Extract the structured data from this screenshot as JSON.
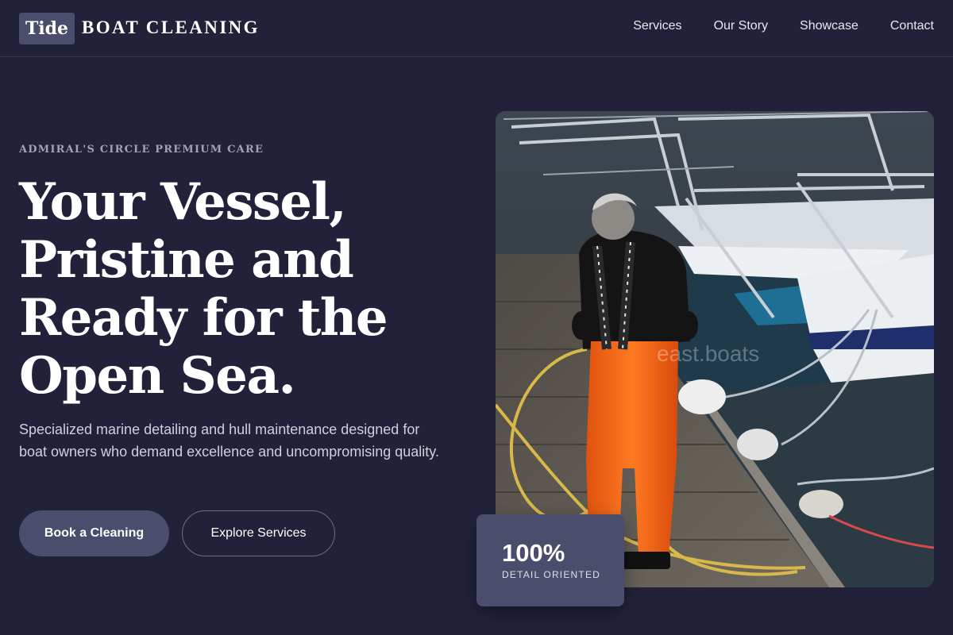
{
  "brand": {
    "logo_mark": "Tide",
    "name": "BOAT CLEANING"
  },
  "nav": {
    "items": [
      {
        "label": "Services"
      },
      {
        "label": "Our Story"
      },
      {
        "label": "Showcase"
      },
      {
        "label": "Contact"
      }
    ]
  },
  "hero": {
    "eyebrow": "ADMIRAL'S CIRCLE PREMIUM CARE",
    "headline": "Your Vessel, Pristine and Ready for the Open Sea.",
    "subtext": "Specialized marine detailing and hull maintenance designed for boat owners who demand excellence and uncompromising quality.",
    "primary_cta": "Book a Cleaning",
    "secondary_cta": "Explore Services"
  },
  "photo": {
    "watermark": "east.boats"
  },
  "stat": {
    "value": "100%",
    "label": "DETAIL ORIENTED"
  },
  "colors": {
    "background": "#21213a",
    "accent": "#4a4d6b",
    "text": "#ffffff",
    "muted": "#a3a0b8"
  }
}
